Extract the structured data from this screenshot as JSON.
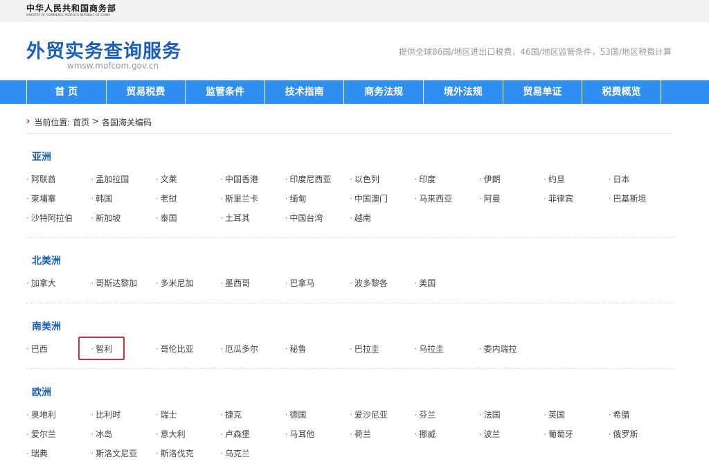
{
  "ministry": {
    "cn": "中华人民共和国商务部",
    "en": "MINISTRY OF COMMERCE PEOPLE'S REPUBLIC OF CHINA"
  },
  "header": {
    "title": "外贸实务查询服务",
    "domain": "wmsw.mofcom.gov.cn",
    "description": "提供全球86国/地区进出口税费，46国/地区监管条件，53国/地区税费计算"
  },
  "nav": [
    "首 页",
    "贸易税费",
    "监管条件",
    "技术指南",
    "商务法规",
    "境外法规",
    "贸易单证",
    "税费概览"
  ],
  "breadcrumb": {
    "prefix": "当前位置:",
    "home": "首页",
    "separator": ">",
    "current": "各国海关编码"
  },
  "regions": [
    {
      "title": "亚洲",
      "countries": [
        "阿联酋",
        "孟加拉国",
        "文莱",
        "中国香港",
        "印度尼西亚",
        "以色列",
        "印度",
        "伊朗",
        "约旦",
        "日本",
        "柬埔寨",
        "韩国",
        "老挝",
        "斯里兰卡",
        "缅甸",
        "中国澳门",
        "马来西亚",
        "阿曼",
        "菲律宾",
        "巴基斯坦",
        "沙特阿拉伯",
        "新加坡",
        "泰国",
        "土耳其",
        "中国台湾",
        "越南"
      ]
    },
    {
      "title": "北美洲",
      "countries": [
        "加拿大",
        "哥斯达黎加",
        "多米尼加",
        "墨西哥",
        "巴拿马",
        "波多黎各",
        "美国"
      ]
    },
    {
      "title": "南美洲",
      "countries": [
        "巴西",
        "智利",
        "哥伦比亚",
        "厄瓜多尔",
        "秘鲁",
        "巴拉圭",
        "乌拉圭",
        "委内瑞拉"
      ]
    },
    {
      "title": "欧洲",
      "countries": [
        "奥地利",
        "比利时",
        "瑞士",
        "捷克",
        "德国",
        "爱沙尼亚",
        "芬兰",
        "法国",
        "英国",
        "希腊",
        "爱尔兰",
        "冰岛",
        "意大利",
        "卢森堡",
        "马耳他",
        "荷兰",
        "挪威",
        "波兰",
        "葡萄牙",
        "俄罗斯",
        "瑞典",
        "斯洛文尼亚",
        "斯洛伐克",
        "乌克兰"
      ]
    }
  ],
  "icons": {
    "breadcrumb_arrow": "chevron-right-icon",
    "bullet": "dot-icon"
  },
  "colors": {
    "nav_bg": "#2f8ff0",
    "title": "#1d5fb8",
    "highlight": "#e0292d",
    "arrow": "#d0141c"
  }
}
